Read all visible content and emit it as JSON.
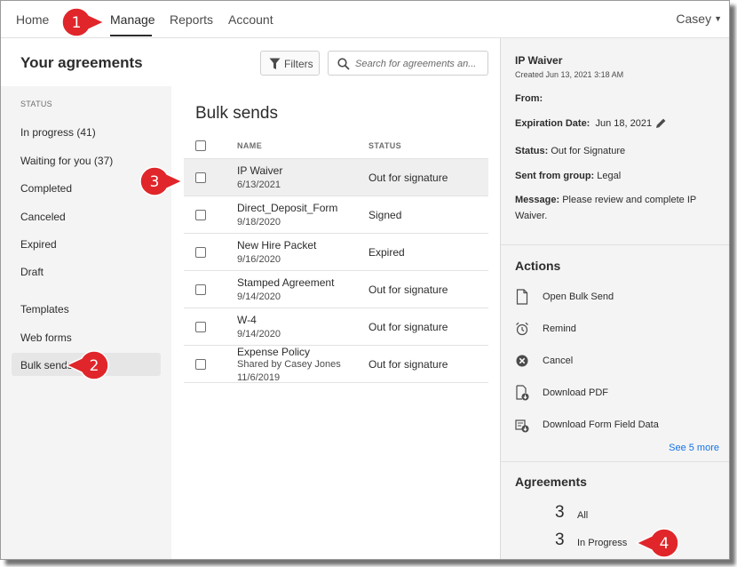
{
  "nav": {
    "items": [
      "Home",
      "Manage",
      "Reports",
      "Account"
    ],
    "user": "Casey"
  },
  "header": {
    "title": "Your agreements",
    "filters_label": "Filters",
    "search_placeholder": "Search for agreements an..."
  },
  "sidebar": {
    "status_heading": "STATUS",
    "status_items": [
      "In progress (41)",
      "Waiting for you (37)",
      "Completed",
      "Canceled",
      "Expired",
      "Draft"
    ],
    "other_items": [
      "Templates",
      "Web forms",
      "Bulk sends"
    ],
    "selected": "Bulk sends"
  },
  "main": {
    "title": "Bulk sends",
    "columns": [
      "NAME",
      "STATUS"
    ],
    "rows": [
      {
        "name": "IP Waiver",
        "sub": "6/13/2021",
        "status": "Out for signature",
        "selected": true
      },
      {
        "name": "Direct_Deposit_Form",
        "sub": "9/18/2020",
        "status": "Signed"
      },
      {
        "name": "New Hire Packet",
        "sub": "9/16/2020",
        "status": "Expired"
      },
      {
        "name": "Stamped Agreement",
        "sub": "9/14/2020",
        "status": "Out for signature"
      },
      {
        "name": "W-4",
        "sub": "9/14/2020",
        "status": "Out for signature"
      },
      {
        "name": "Expense Policy",
        "sub": "Shared by Casey Jones",
        "sub2": "11/6/2019",
        "status": "Out for signature"
      }
    ]
  },
  "details": {
    "title": "IP Waiver",
    "created": "Created Jun 13, 2021 3:18 AM",
    "from_label": "From:",
    "from_value": "",
    "expiration_label": "Expiration Date:",
    "expiration_value": "Jun 18, 2021",
    "status_label": "Status:",
    "status_value": "Out for Signature",
    "group_label": "Sent from group:",
    "group_value": "Legal",
    "message_label": "Message:",
    "message_line1": "Please review and complete IP",
    "message_line2": "Waiver."
  },
  "actions": {
    "title": "Actions",
    "items": [
      {
        "label": "Open Bulk Send",
        "icon": "document-icon"
      },
      {
        "label": "Remind",
        "icon": "alarm-clock-icon"
      },
      {
        "label": "Cancel",
        "icon": "cancel-circle-icon"
      },
      {
        "label": "Download PDF",
        "icon": "download-pdf-icon"
      },
      {
        "label": "Download Form Field Data",
        "icon": "download-data-icon"
      }
    ],
    "see_more": "See 5 more"
  },
  "agreements": {
    "title": "Agreements",
    "counts": [
      {
        "value": "3",
        "label": "All"
      },
      {
        "value": "3",
        "label": "In Progress"
      }
    ]
  },
  "callouts": [
    "1",
    "2",
    "3",
    "4"
  ],
  "colors": {
    "callout_red": "#e0262b",
    "link_blue": "#1473e6",
    "panel_gray": "#f4f4f4"
  }
}
